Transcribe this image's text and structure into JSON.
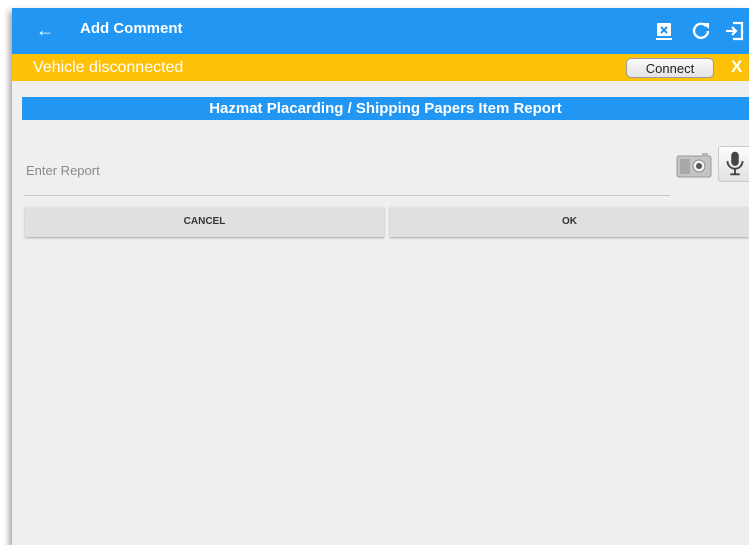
{
  "appbar": {
    "title": "Add Comment",
    "back_icon": "arrow-left-icon",
    "actions": [
      "disconnect-device-icon",
      "refresh-icon",
      "logout-icon"
    ]
  },
  "banner": {
    "message": "Vehicle disconnected",
    "connect_label": "Connect",
    "close_label": "X"
  },
  "section": {
    "title": "Hazmat Placarding / Shipping Papers Item Report"
  },
  "report": {
    "placeholder": "Enter Report",
    "value": "",
    "camera_icon": "camera-icon",
    "mic_icon": "microphone-icon"
  },
  "buttons": {
    "cancel_label": "CANCEL",
    "ok_label": "OK"
  },
  "colors": {
    "appbar": "#2196f3",
    "banner": "#ffc107",
    "section_bar": "#2196f3",
    "background": "#efefef"
  }
}
